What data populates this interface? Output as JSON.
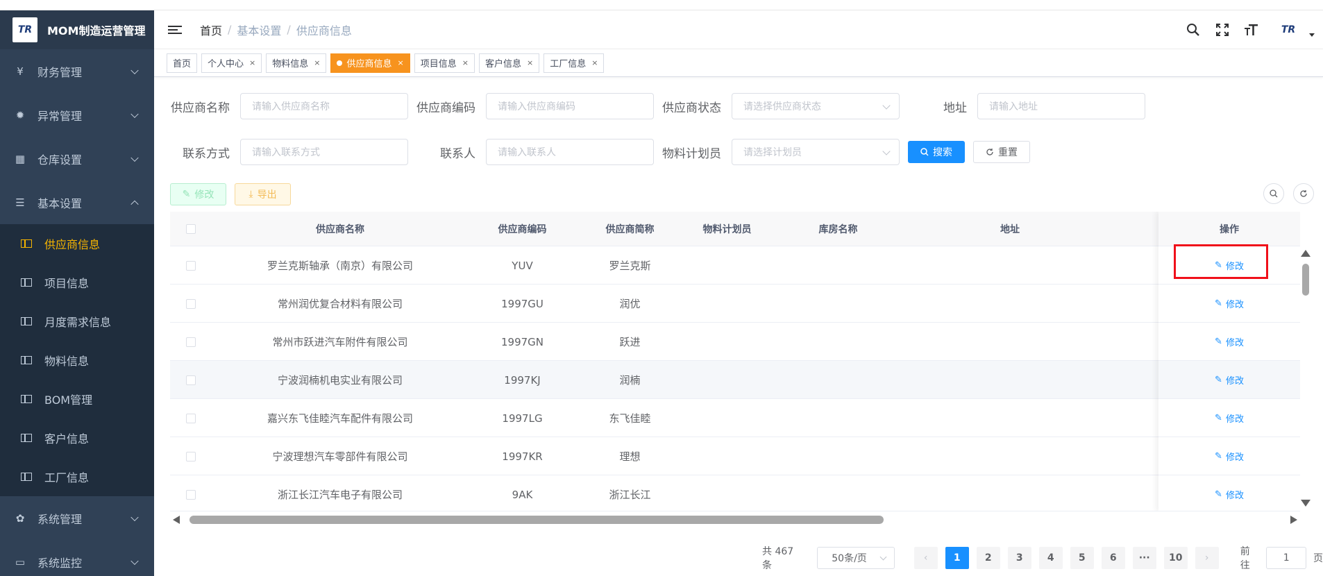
{
  "app": {
    "logo_text": "TR",
    "title": "MOM制造运营管理"
  },
  "sidebar": {
    "items": [
      {
        "icon": "¥",
        "label": "财务管理"
      },
      {
        "icon": "✹",
        "label": "异常管理"
      },
      {
        "icon": "▦",
        "label": "仓库设置"
      },
      {
        "icon": "☰",
        "label": "基本设置"
      },
      {
        "icon": "✿",
        "label": "系统管理"
      },
      {
        "icon": "▭",
        "label": "系统监控"
      }
    ],
    "submenu": [
      {
        "label": "供应商信息",
        "active": true
      },
      {
        "label": "项目信息"
      },
      {
        "label": "月度需求信息"
      },
      {
        "label": "物料信息"
      },
      {
        "label": "BOM管理"
      },
      {
        "label": "客户信息"
      },
      {
        "label": "工厂信息"
      }
    ]
  },
  "breadcrumb": {
    "home": "首页",
    "level1": "基本设置",
    "level2": "供应商信息",
    "sep": "/"
  },
  "header": {
    "avatar_text": "TR"
  },
  "tags": [
    {
      "label": "首页"
    },
    {
      "label": "个人中心",
      "close": "×"
    },
    {
      "label": "物料信息",
      "close": "×"
    },
    {
      "label": "供应商信息",
      "close": "×",
      "active": true
    },
    {
      "label": "项目信息",
      "close": "×"
    },
    {
      "label": "客户信息",
      "close": "×"
    },
    {
      "label": "工厂信息",
      "close": "×"
    }
  ],
  "filters": {
    "supplier_name": {
      "label": "供应商名称",
      "placeholder": "请输入供应商名称"
    },
    "supplier_code": {
      "label": "供应商编码",
      "placeholder": "请输入供应商编码"
    },
    "supplier_status": {
      "label": "供应商状态",
      "placeholder": "请选择供应商状态"
    },
    "address": {
      "label": "地址",
      "placeholder": "请输入地址"
    },
    "contact": {
      "label": "联系方式",
      "placeholder": "请输入联系方式"
    },
    "contact_person": {
      "label": "联系人",
      "placeholder": "请输入联系人"
    },
    "planner": {
      "label": "物料计划员",
      "placeholder": "请选择计划员"
    },
    "search_label": "搜索",
    "reset_label": "重置"
  },
  "toolbar": {
    "edit_label": "修改",
    "export_label": "导出"
  },
  "table": {
    "columns": [
      "供应商名称",
      "供应商编码",
      "供应商简称",
      "物料计划员",
      "库房名称",
      "地址",
      "操作"
    ],
    "op_label": "修改",
    "rows": [
      {
        "name": "罗兰克斯轴承（南京）有限公司",
        "code": "YUV",
        "short": "罗兰克斯"
      },
      {
        "name": "常州润优复合材料有限公司",
        "code": "1997GU",
        "short": "润优"
      },
      {
        "name": "常州市跃进汽车附件有限公司",
        "code": "1997GN",
        "short": "跃进"
      },
      {
        "name": "宁波润楠机电实业有限公司",
        "code": "1997KJ",
        "short": "润楠"
      },
      {
        "name": "嘉兴东飞佳睦汽车配件有限公司",
        "code": "1997LG",
        "short": "东飞佳睦"
      },
      {
        "name": "宁波理想汽车零部件有限公司",
        "code": "1997KR",
        "short": "理想"
      },
      {
        "name": "浙江长江汽车电子有限公司",
        "code": "9AK",
        "short": "浙江长江"
      }
    ]
  },
  "pagination": {
    "total": "共 467 条",
    "page_size": "50条/页",
    "pages": [
      "1",
      "2",
      "3",
      "4",
      "5",
      "6",
      "···",
      "10"
    ],
    "current": "1",
    "goto_prefix": "前往",
    "goto_value": "1",
    "goto_suffix": "页"
  }
}
